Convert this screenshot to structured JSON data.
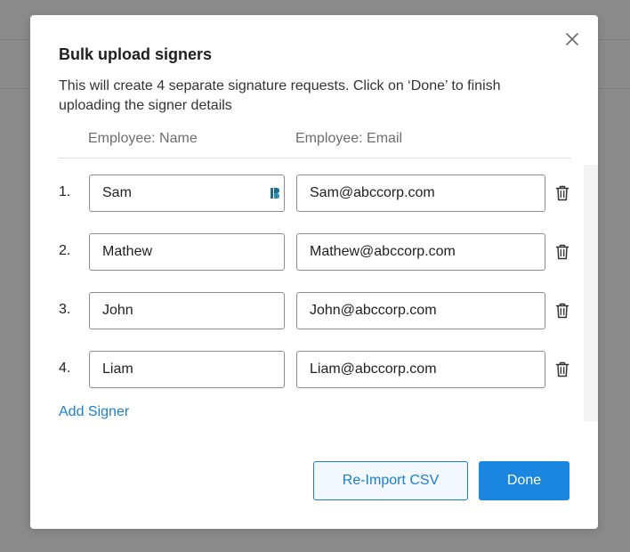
{
  "modal": {
    "title": "Bulk upload signers",
    "description": "This will create 4 separate signature requests. Click on ‘Done’ to finish uploading the signer details",
    "columns": {
      "name": "Employee: Name",
      "email": "Employee: Email"
    },
    "rows": [
      {
        "index": "1.",
        "name": "Sam",
        "email": "Sam@abccorp.com"
      },
      {
        "index": "2.",
        "name": "Mathew",
        "email": "Mathew@abccorp.com"
      },
      {
        "index": "3.",
        "name": "John",
        "email": "John@abccorp.com"
      },
      {
        "index": "4.",
        "name": "Liam",
        "email": "Liam@abccorp.com"
      }
    ],
    "add_signer_label": "Add Signer",
    "reimport_label": "Re-Import CSV",
    "done_label": "Done"
  },
  "icons": {
    "close": "close-icon",
    "delete": "trash-icon",
    "password_manager": "password-manager-icon"
  },
  "colors": {
    "accent": "#1a86e0",
    "link": "#1a7fd4",
    "backdrop": "#8a8a8a"
  }
}
